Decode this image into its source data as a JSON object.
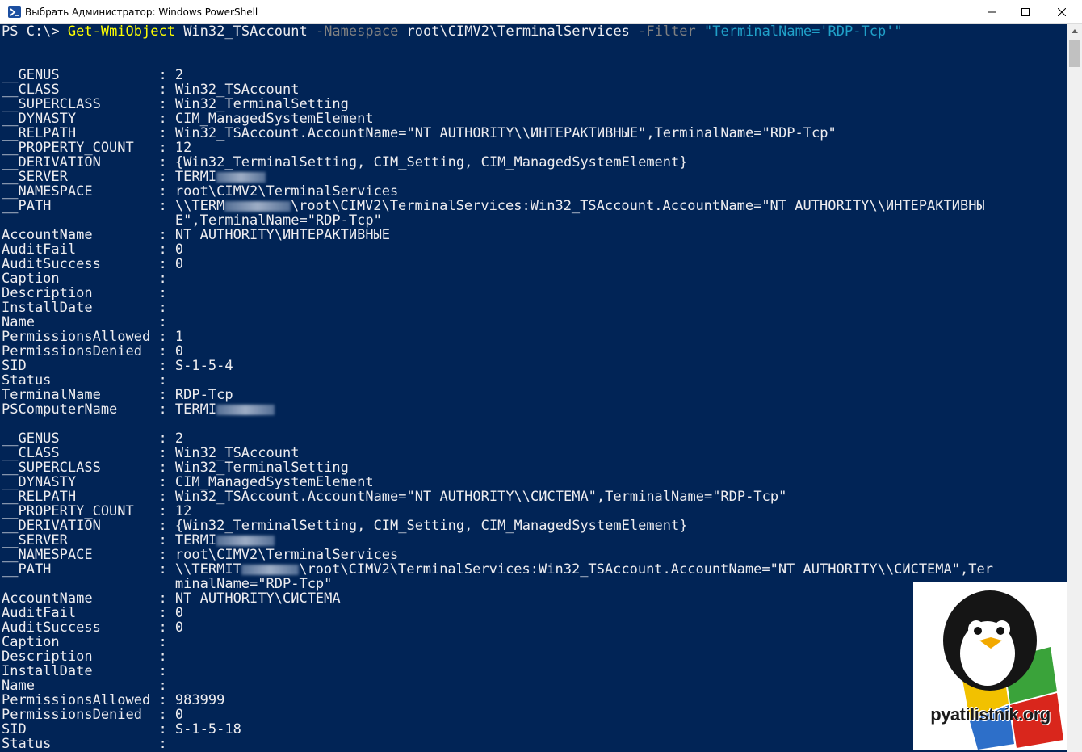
{
  "window": {
    "title": "Выбрать Администратор: Windows PowerShell"
  },
  "command": {
    "prompt": "PS C:\\> ",
    "cmdlet": "Get-WmiObject",
    "class_arg": " Win32_TSAccount ",
    "namespace_param": "-Namespace",
    "namespace_value": " root\\CIMV2\\TerminalServices ",
    "filter_param": "-Filter",
    "filter_value": " \"TerminalName='RDP-Tcp'\""
  },
  "lines": [
    {
      "t": "__GENUS            : 2"
    },
    {
      "t": "__CLASS            : Win32_TSAccount"
    },
    {
      "t": "__SUPERCLASS       : Win32_TerminalSetting"
    },
    {
      "t": "__DYNASTY          : CIM_ManagedSystemElement"
    },
    {
      "t": "__RELPATH          : Win32_TSAccount.AccountName=\"NT AUTHORITY\\\\ИНТЕРАКТИВНЫЕ\",TerminalName=\"RDP-Tcp\""
    },
    {
      "t": "__PROPERTY_COUNT   : 12"
    },
    {
      "t": "__DERIVATION       : {Win32_TerminalSetting, CIM_Setting, CIM_ManagedSystemElement}"
    },
    {
      "t": "__SERVER           : TERMI",
      "r": 6
    },
    {
      "t": "__NAMESPACE        : root\\CIMV2\\TerminalServices"
    },
    {
      "t": "__PATH             : \\\\TERM",
      "r": 8,
      "t2": "\\root\\CIMV2\\TerminalServices:Win32_TSAccount.AccountName=\"NT AUTHORITY\\\\ИНТЕРАКТИВНЫ"
    },
    {
      "t": "                     E\",TerminalName=\"RDP-Tcp\""
    },
    {
      "t": "AccountName        : NT AUTHORITY\\ИНТЕРАКТИВНЫЕ"
    },
    {
      "t": "AuditFail          : 0"
    },
    {
      "t": "AuditSuccess       : 0"
    },
    {
      "t": "Caption            :"
    },
    {
      "t": "Description        :"
    },
    {
      "t": "InstallDate        :"
    },
    {
      "t": "Name               :"
    },
    {
      "t": "PermissionsAllowed : 1"
    },
    {
      "t": "PermissionsDenied  : 0"
    },
    {
      "t": "SID                : S-1-5-4"
    },
    {
      "t": "Status             :"
    },
    {
      "t": "TerminalName       : RDP-Tcp"
    },
    {
      "t": "PSComputerName     : TERMI",
      "r": 7
    },
    {
      "t": ""
    },
    {
      "t": "__GENUS            : 2"
    },
    {
      "t": "__CLASS            : Win32_TSAccount"
    },
    {
      "t": "__SUPERCLASS       : Win32_TerminalSetting"
    },
    {
      "t": "__DYNASTY          : CIM_ManagedSystemElement"
    },
    {
      "t": "__RELPATH          : Win32_TSAccount.AccountName=\"NT AUTHORITY\\\\СИСТЕМА\",TerminalName=\"RDP-Tcp\""
    },
    {
      "t": "__PROPERTY_COUNT   : 12"
    },
    {
      "t": "__DERIVATION       : {Win32_TerminalSetting, CIM_Setting, CIM_ManagedSystemElement}"
    },
    {
      "t": "__SERVER           : TERMI",
      "r": 7
    },
    {
      "t": "__NAMESPACE        : root\\CIMV2\\TerminalServices"
    },
    {
      "t": "__PATH             : \\\\TERMIT",
      "r": 7,
      "t2": "\\root\\CIMV2\\TerminalServices:Win32_TSAccount.AccountName=\"NT AUTHORITY\\\\СИСТЕМА\",Ter"
    },
    {
      "t": "                     minalName=\"RDP-Tcp\""
    },
    {
      "t": "AccountName        : NT AUTHORITY\\СИСТЕМА"
    },
    {
      "t": "AuditFail          : 0"
    },
    {
      "t": "AuditSuccess       : 0"
    },
    {
      "t": "Caption            :"
    },
    {
      "t": "Description        :"
    },
    {
      "t": "InstallDate        :"
    },
    {
      "t": "Name               :"
    },
    {
      "t": "PermissionsAllowed : 983999"
    },
    {
      "t": "PermissionsDenied  : 0"
    },
    {
      "t": "SID                : S-1-5-18"
    },
    {
      "t": "Status             :"
    }
  ],
  "watermark": {
    "text": "pyatilistnik.org"
  },
  "icons": {
    "app": "powershell-icon",
    "minimize": "minimize-icon",
    "maximize": "maximize-icon",
    "close": "close-icon",
    "scroll_up": "scroll-up-arrow-icon"
  },
  "colors": {
    "console_bg": "#012456",
    "console_fg": "#eeedf0",
    "cmdlet": "#ffff00",
    "parameter": "#808080",
    "string": "#20a0c8"
  }
}
